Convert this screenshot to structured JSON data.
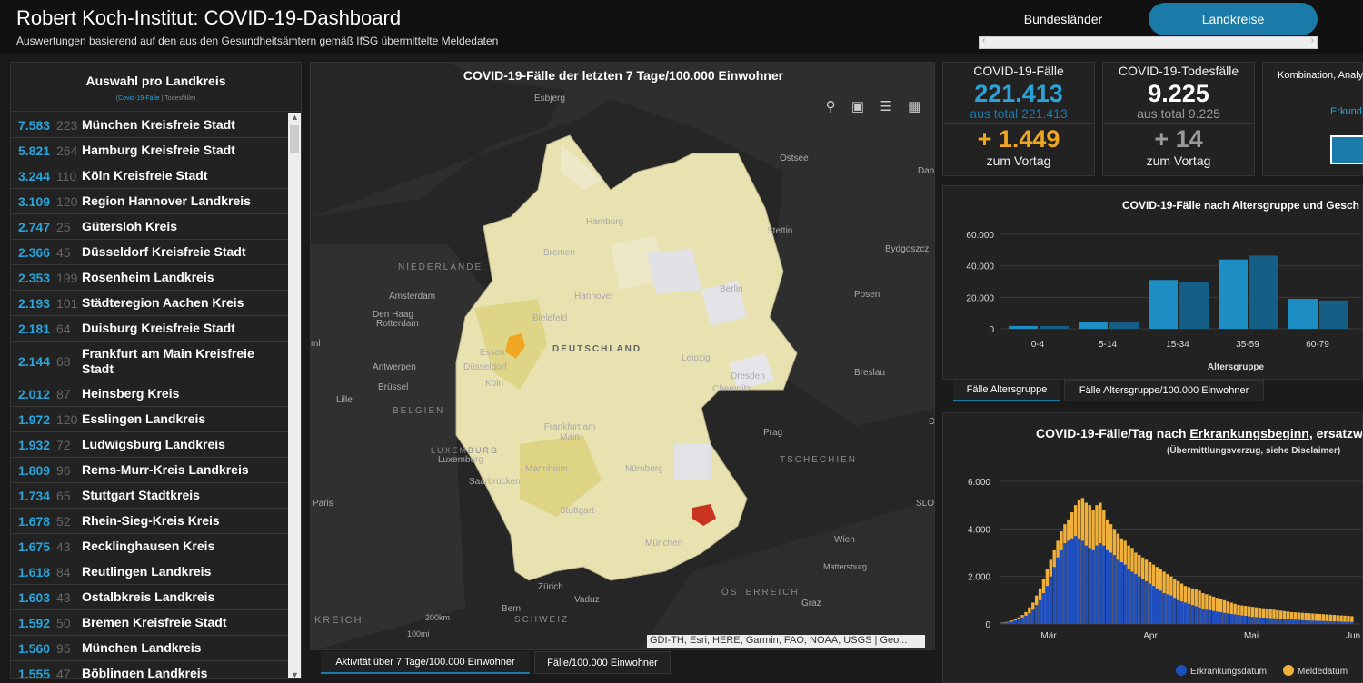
{
  "header": {
    "title": "Robert Koch-Institut: COVID-19-Dashboard",
    "subtitle": "Auswertungen basierend auf den aus den Gesundheitsämtern gemäß IfSG übermittelte Meldedaten",
    "tab_bundeslaender": "Bundesländer",
    "tab_landkreise": "Landkreise"
  },
  "list": {
    "title": "Auswahl pro Landkreis",
    "legend_cases": "Covid-19-Fälle",
    "legend_sep": " | ",
    "legend_deaths": "Todesfälle",
    "rows": [
      {
        "cases": "7.583",
        "deaths": "223",
        "name": "München Kreisfreie Stadt"
      },
      {
        "cases": "5.821",
        "deaths": "264",
        "name": "Hamburg Kreisfreie Stadt"
      },
      {
        "cases": "3.244",
        "deaths": "110",
        "name": "Köln Kreisfreie Stadt"
      },
      {
        "cases": "3.109",
        "deaths": "120",
        "name": "Region Hannover Landkreis"
      },
      {
        "cases": "2.747",
        "deaths": "25",
        "name": "Gütersloh Kreis"
      },
      {
        "cases": "2.366",
        "deaths": "45",
        "name": "Düsseldorf Kreisfreie Stadt"
      },
      {
        "cases": "2.353",
        "deaths": "199",
        "name": "Rosenheim Landkreis"
      },
      {
        "cases": "2.193",
        "deaths": "101",
        "name": "Städteregion Aachen Kreis"
      },
      {
        "cases": "2.181",
        "deaths": "64",
        "name": "Duisburg Kreisfreie Stadt"
      },
      {
        "cases": "2.144",
        "deaths": "68",
        "name": "Frankfurt am Main Kreisfreie Stadt"
      },
      {
        "cases": "2.012",
        "deaths": "87",
        "name": "Heinsberg Kreis"
      },
      {
        "cases": "1.972",
        "deaths": "120",
        "name": "Esslingen Landkreis"
      },
      {
        "cases": "1.932",
        "deaths": "72",
        "name": "Ludwigsburg Landkreis"
      },
      {
        "cases": "1.809",
        "deaths": "96",
        "name": "Rems-Murr-Kreis Landkreis"
      },
      {
        "cases": "1.734",
        "deaths": "65",
        "name": "Stuttgart Stadtkreis"
      },
      {
        "cases": "1.678",
        "deaths": "52",
        "name": "Rhein-Sieg-Kreis Kreis"
      },
      {
        "cases": "1.675",
        "deaths": "43",
        "name": "Recklinghausen Kreis"
      },
      {
        "cases": "1.618",
        "deaths": "84",
        "name": "Reutlingen Landkreis"
      },
      {
        "cases": "1.603",
        "deaths": "43",
        "name": "Ostalbkreis Landkreis"
      },
      {
        "cases": "1.592",
        "deaths": "50",
        "name": "Bremen Kreisfreie Stadt"
      },
      {
        "cases": "1.560",
        "deaths": "95",
        "name": "München Landkreis"
      },
      {
        "cases": "1.555",
        "deaths": "47",
        "name": "Böblingen Landkreis"
      }
    ]
  },
  "map": {
    "title": "COVID-19-Fälle der letzten 7 Tage/100.000 Einwohner",
    "attribution": "GDI-TH, Esri, HERE, Garmin, FAO, NOAA, USGS | Geo...",
    "tab_activity": "Aktivität über 7 Tage/100.000 Einwohner",
    "tab_cases": "Fälle/100.000 Einwohner",
    "scale_km": "200km",
    "scale_mi": "100mi",
    "labels": {
      "esbjerg": "Esbjerg",
      "ostsee": "Ostsee",
      "hamburg": "Hamburg",
      "bremen": "Bremen",
      "stettin": "Stettin",
      "bydgoszcz": "Bydgoszcz",
      "niederlande": "NIEDERLANDE",
      "amsterdam": "Amsterdam",
      "denhaag": "Den Haag",
      "rotterdam": "Rotterdam",
      "hannover": "Hannover",
      "berlin": "Berlin",
      "bielefeld": "Bielefeld",
      "posen": "Posen",
      "deutschland": "DEUTSCHLAND",
      "essen": "Essen",
      "duesseldorf": "Düsseldorf",
      "leipzig": "Leipzig",
      "antwerpen": "Antwerpen",
      "bruessel": "Brüssel",
      "koeln": "Köln",
      "dresden": "Dresden",
      "breslau": "Breslau",
      "lille": "Lille",
      "belgien": "BELGIEN",
      "chemnitz": "Chemnitz",
      "frankfurt": "Frankfurt am Main",
      "prag": "Prag",
      "luxemburg_c": "LUXEMBURG",
      "luxemburg": "Luxemburg",
      "tschechien": "TSCHECHIEN",
      "mannheim": "Mannheim",
      "nuernberg": "Nürnberg",
      "saarbruecken": "Saarbrücken",
      "paris": "Paris",
      "stuttgart": "Stuttgart",
      "muenchen": "München",
      "wien": "Wien",
      "mattersburg": "Mattersburg",
      "zuerich": "Zürich",
      "vaduz": "Vaduz",
      "oesterreich": "ÖSTERREICH",
      "graz": "Graz",
      "bern": "Bern",
      "schweiz": "SCHWEIZ",
      "frankreich": "KREICH",
      "ml": "ml",
      "dan": "Dan",
      "slo": "SLO"
    }
  },
  "indicators": {
    "cases": {
      "label": "COVID-19-Fälle",
      "value": "221.413",
      "total": "aus total 221.413",
      "delta": "+ 1.449",
      "delta_label": "zum Vortag"
    },
    "deaths": {
      "label": "COVID-19-Todesfälle",
      "value": "9.225",
      "total": "aus total 9.225",
      "delta": "+ 14",
      "delta_label": "zum Vortag"
    },
    "combo": {
      "label": "Kombination, Analy",
      "link": "Erkund"
    }
  },
  "age_chart": {
    "title": "COVID-19-Fälle nach Altersgruppe und Gesch",
    "tab_age": "Fälle Altersgruppe",
    "tab_age_rate": "Fälle Altersgruppe/100.000 Einwohner"
  },
  "daily_chart": {
    "title_pre": "COVID-19-Fälle/Tag nach ",
    "title_link": "Erkrankungsbeginn",
    "title_post": ", ersatzw",
    "subtitle": "(Übermittlungsverzug, siehe Disclaimer)"
  },
  "colors": {
    "accent": "#1a7aa8",
    "cases_blue": "#2aa3d9",
    "delta_orange": "#f0a623",
    "bar_blue": "#1d8ec3",
    "bar_dark_blue": "#155f86",
    "erkrankung_blue": "#1f4fbf",
    "meldedatum_yellow": "#f0b03a"
  },
  "chart_data": [
    {
      "type": "bar",
      "title": "COVID-19-Fälle nach Altersgruppe und Gesch",
      "xlabel": "Altersgruppe",
      "ylabel": "",
      "categories": [
        "0-4",
        "5-14",
        "15-34",
        "35-59",
        "60-79"
      ],
      "ylim": [
        0,
        60000
      ],
      "yticks": [
        "0",
        "20.000",
        "40.000",
        "60.000"
      ],
      "series": [
        {
          "values": [
            1800,
            4500,
            31000,
            44000,
            19000
          ]
        },
        {
          "values": [
            1700,
            4000,
            30000,
            46500,
            18000
          ]
        }
      ]
    },
    {
      "type": "bar",
      "title": "COVID-19-Fälle/Tag nach Erkrankungsbeginn, ersatzw",
      "ylim": [
        0,
        6000
      ],
      "yticks": [
        "0",
        "2.000",
        "4.000",
        "6.000"
      ],
      "xticks": [
        "Mär",
        "Apr",
        "Mai",
        "Jun"
      ],
      "legend": [
        "Erkrankungsdatum",
        "Meldedatum"
      ],
      "series": [
        {
          "name": "Erkrankungsdatum",
          "values": [
            50,
            60,
            80,
            100,
            150,
            200,
            280,
            350,
            450,
            600,
            800,
            1000,
            1300,
            1600,
            2000,
            2400,
            2800,
            3100,
            3400,
            3500,
            3600,
            3700,
            3600,
            3500,
            3300,
            3200,
            3100,
            3300,
            3400,
            3300,
            3100,
            3000,
            2900,
            2700,
            2600,
            2500,
            2300,
            2200,
            2100,
            2000,
            1900,
            1800,
            1700,
            1600,
            1500,
            1400,
            1300,
            1250,
            1200,
            1100,
            1000,
            950,
            900,
            850,
            800,
            750,
            700,
            650,
            600,
            580,
            550,
            520,
            500,
            470,
            450,
            420,
            400,
            380,
            360,
            340,
            320,
            300,
            290,
            280,
            270,
            260,
            250,
            240,
            230,
            220,
            210,
            200,
            190,
            180,
            170,
            160,
            150,
            145,
            140,
            135,
            130,
            125,
            120,
            115,
            110,
            105,
            100,
            95,
            90,
            85
          ]
        },
        {
          "name": "Meldedatum",
          "values": [
            60,
            80,
            100,
            150,
            200,
            280,
            380,
            500,
            700,
            900,
            1200,
            1500,
            1900,
            2300,
            2700,
            3100,
            3500,
            3900,
            4200,
            4400,
            4700,
            5000,
            5200,
            5300,
            5100,
            5000,
            4800,
            5000,
            5100,
            4800,
            4400,
            4200,
            4000,
            3800,
            3600,
            3500,
            3300,
            3200,
            3000,
            2900,
            2800,
            2700,
            2600,
            2500,
            2400,
            2300,
            2200,
            2100,
            2000,
            1900,
            1800,
            1700,
            1600,
            1550,
            1500,
            1450,
            1400,
            1300,
            1250,
            1200,
            1150,
            1100,
            1050,
            1000,
            950,
            900,
            850,
            800,
            780,
            760,
            740,
            720,
            700,
            680,
            660,
            640,
            620,
            600,
            580,
            560,
            540,
            520,
            500,
            490,
            480,
            470,
            460,
            450,
            440,
            430,
            420,
            410,
            400,
            390,
            380,
            370,
            360,
            350,
            340,
            330
          ]
        }
      ]
    }
  ]
}
